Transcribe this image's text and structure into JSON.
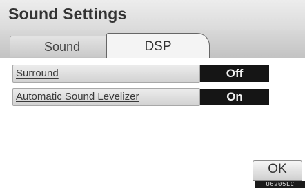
{
  "header": {
    "title": "Sound Settings"
  },
  "tabs": [
    {
      "label": "Sound",
      "selected": false
    },
    {
      "label": "DSP",
      "selected": true
    }
  ],
  "settings": [
    {
      "label": "Surround",
      "value": "Off"
    },
    {
      "label": "Automatic Sound Levelizer",
      "value": "On"
    }
  ],
  "footer": {
    "ok_label": "OK",
    "code": "U6205LC"
  },
  "colors": {
    "value_background": "#151515",
    "value_text": "#f2f2f2"
  }
}
